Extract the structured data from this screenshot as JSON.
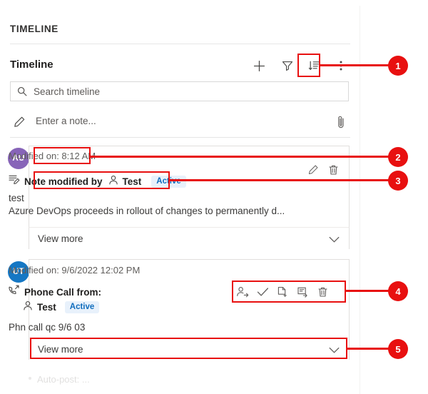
{
  "panel": {
    "section_header": "TIMELINE",
    "title": "Timeline"
  },
  "toolbar": {
    "add_label": "add-record",
    "filter_label": "filter-timeline",
    "sort_label": "sort-timeline",
    "more_label": "more-commands"
  },
  "search": {
    "placeholder": "Search timeline",
    "value": ""
  },
  "note": {
    "placeholder": "Enter a note...",
    "value": "",
    "attach_label": "attach-file"
  },
  "entries": [
    {
      "avatar_initials": "AU",
      "avatar_color": "#8764b8",
      "modified_on": "Modified on: 8:12 AM",
      "title": "Note modified by",
      "person": "Test",
      "status": "Active",
      "body_line_1": "test",
      "body_line_2": "Azure DevOps proceeds in rollout of changes to permanently d...",
      "view_more": "View more",
      "actions": [
        "edit-icon",
        "delete-icon"
      ]
    },
    {
      "avatar_initials": "UT",
      "avatar_color": "#1577c4",
      "modified_on": "Modified on: 9/6/2022 12:02 PM",
      "title": "Phone Call from:",
      "person": "Test",
      "status": "Active",
      "body_line_1": "Phn call qc 9/6 03",
      "body_line_2": "",
      "view_more": "View more",
      "actions": [
        "assign-icon",
        "mark-complete-icon",
        "add-to-queue-icon",
        "convert-to-icon",
        "delete-icon"
      ]
    }
  ],
  "faded_row": {
    "text": "Auto-post: ..."
  },
  "annotations": {
    "markers": [
      "1",
      "2",
      "3",
      "4",
      "5"
    ],
    "color": "#e81010"
  }
}
